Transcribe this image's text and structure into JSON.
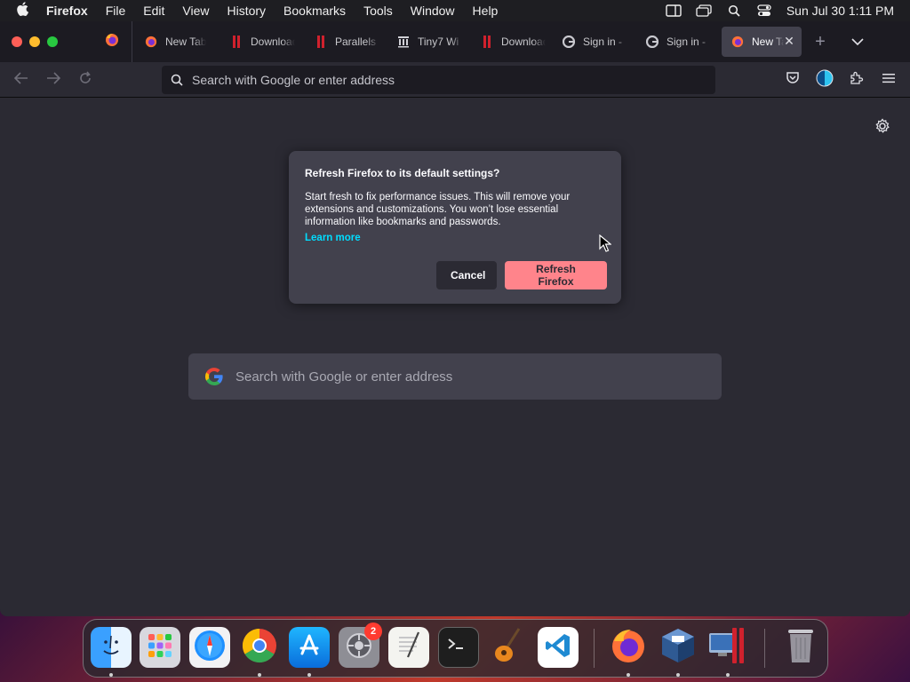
{
  "menubar": {
    "app_name": "Firefox",
    "menus": [
      "File",
      "Edit",
      "View",
      "History",
      "Bookmarks",
      "Tools",
      "Window",
      "Help"
    ],
    "clock": "Sun Jul 30  1:11 PM",
    "status_icons": [
      "sidebar-icon",
      "window-icon",
      "spotlight-search-icon",
      "control-center-icon"
    ]
  },
  "tabs": [
    {
      "label": "New Tab",
      "favicon": "firefox-icon"
    },
    {
      "label": "Download",
      "favicon": "parallels-icon"
    },
    {
      "label": "Parallels",
      "favicon": "parallels-icon"
    },
    {
      "label": "Tiny7 Wi",
      "favicon": "archive-icon"
    },
    {
      "label": "Download",
      "favicon": "parallels-icon"
    },
    {
      "label": "Sign in -",
      "favicon": "google-icon"
    },
    {
      "label": "Sign in -",
      "favicon": "google-icon"
    },
    {
      "label": "New Tab",
      "favicon": "firefox-icon",
      "active": true
    }
  ],
  "urlbar": {
    "placeholder": "Search with Google or enter address"
  },
  "content": {
    "search_placeholder": "Search with Google or enter address"
  },
  "dialog": {
    "title": "Refresh Firefox to its default settings?",
    "body": "Start fresh to fix performance issues. This will remove your extensions and customizations. You won’t lose essential information like bookmarks and passwords.",
    "link": "Learn more",
    "cancel_label": "Cancel",
    "confirm_label": "Refresh Firefox"
  },
  "dock": {
    "items": [
      "Finder",
      "Launchpad",
      "Safari",
      "Google Chrome",
      "App Store",
      "System Settings",
      "TextEdit",
      "Terminal",
      "GarageBand",
      "Visual Studio Code",
      "Firefox",
      "VirtualBox",
      "Parallels Desktop",
      "Trash"
    ],
    "settings_badge": "2"
  },
  "colors": {
    "accent_button": "#ff848b",
    "link": "#00ddff",
    "window_bg": "#2b2a33"
  }
}
